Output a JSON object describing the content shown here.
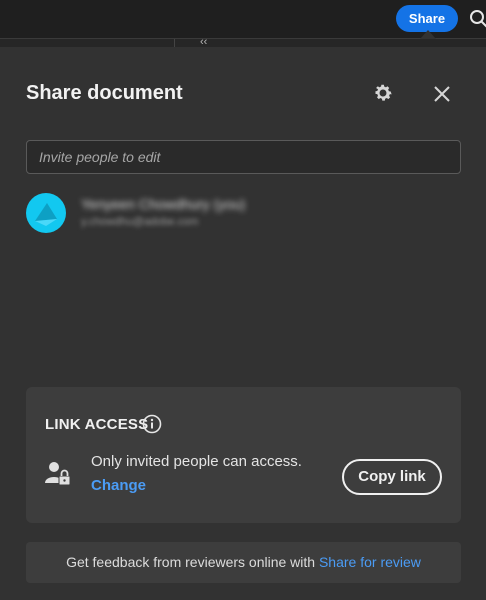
{
  "topbar": {
    "share_label": "Share",
    "search_icon": "search-icon",
    "collapse_glyph": "‹‹"
  },
  "dialog": {
    "title": "Share document",
    "settings_icon": "gear-icon",
    "close_icon": "close-icon",
    "invite": {
      "placeholder": "Invite people to edit",
      "value": ""
    },
    "people": [
      {
        "name": "Yenyeen Chowdhury (you)",
        "email": "y.chowdhu@adobe.com",
        "avatar_color": "#12c8f0"
      }
    ]
  },
  "link_access": {
    "heading": "LINK ACCESS",
    "info_icon": "info-icon",
    "access_icon": "user-lock-icon",
    "description": "Only invited people can access.",
    "change_label": "Change",
    "copy_link_label": "Copy link"
  },
  "footer": {
    "text": "Get feedback from reviewers online with ",
    "link_label": "Share for review"
  },
  "colors": {
    "accent": "#1473e6",
    "link": "#4b9cf5",
    "panel": "#323232",
    "card": "#3d3d3d"
  }
}
